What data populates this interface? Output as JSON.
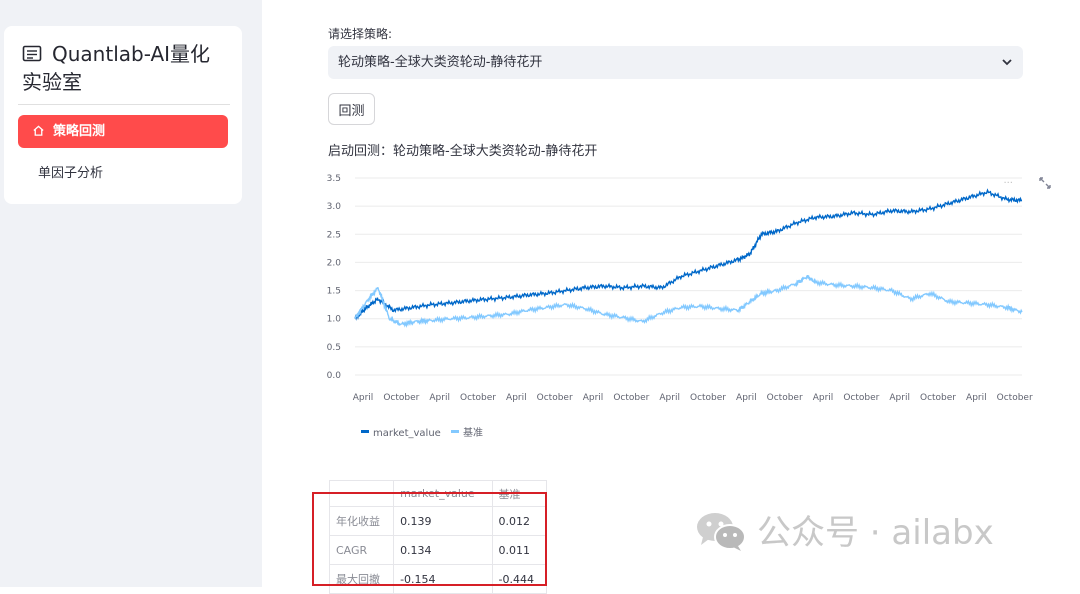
{
  "sidebar": {
    "title": "Quantlab-AI量化实验室",
    "items": [
      {
        "label": "策略回测",
        "active": true
      },
      {
        "label": "单因子分析",
        "active": false
      }
    ]
  },
  "main": {
    "select_label": "请选择策略:",
    "select_value": "轮动策略-全球大类资轮动-静待花开",
    "run_button": "回测",
    "status": "启动回测：轮动策略-全球大类资轮动-静待花开"
  },
  "chart_data": {
    "type": "line",
    "title": "",
    "xlabel": "",
    "ylabel": "",
    "ylim": [
      0,
      3.5
    ],
    "yticks": [
      "0.0",
      "0.5",
      "1.0",
      "1.5",
      "2.0",
      "2.5",
      "3.0",
      "3.5"
    ],
    "xticks": [
      "April",
      "October",
      "April",
      "October",
      "April",
      "October",
      "April",
      "October",
      "April",
      "October",
      "April",
      "October",
      "April",
      "October",
      "April",
      "October",
      "April",
      "October"
    ],
    "grid": true,
    "legend": "bottom-left",
    "series": [
      {
        "name": "market_value",
        "color": "#0068c9",
        "points": [
          [
            0,
            1.0
          ],
          [
            0.3,
            1.2
          ],
          [
            0.6,
            1.35
          ],
          [
            1.0,
            1.15
          ],
          [
            1.5,
            1.2
          ],
          [
            2.0,
            1.25
          ],
          [
            2.5,
            1.28
          ],
          [
            3.0,
            1.32
          ],
          [
            3.5,
            1.35
          ],
          [
            4.0,
            1.38
          ],
          [
            4.5,
            1.42
          ],
          [
            5.0,
            1.45
          ],
          [
            5.5,
            1.5
          ],
          [
            6.0,
            1.55
          ],
          [
            6.5,
            1.58
          ],
          [
            7.0,
            1.55
          ],
          [
            7.5,
            1.58
          ],
          [
            8.0,
            1.55
          ],
          [
            8.5,
            1.75
          ],
          [
            9.0,
            1.85
          ],
          [
            9.5,
            1.95
          ],
          [
            10.0,
            2.05
          ],
          [
            10.3,
            2.15
          ],
          [
            10.6,
            2.5
          ],
          [
            11.0,
            2.55
          ],
          [
            11.5,
            2.7
          ],
          [
            12.0,
            2.8
          ],
          [
            12.5,
            2.82
          ],
          [
            13.0,
            2.88
          ],
          [
            13.5,
            2.85
          ],
          [
            14.0,
            2.92
          ],
          [
            14.5,
            2.9
          ],
          [
            15.0,
            2.95
          ],
          [
            15.5,
            3.05
          ],
          [
            16.0,
            3.15
          ],
          [
            16.5,
            3.25
          ],
          [
            17.0,
            3.12
          ],
          [
            17.4,
            3.1
          ]
        ]
      },
      {
        "name": "基准",
        "color": "#83c9ff",
        "points": [
          [
            0,
            1.0
          ],
          [
            0.3,
            1.3
          ],
          [
            0.6,
            1.55
          ],
          [
            0.9,
            1.0
          ],
          [
            1.2,
            0.9
          ],
          [
            1.6,
            0.95
          ],
          [
            2.0,
            0.97
          ],
          [
            2.5,
            1.0
          ],
          [
            3.0,
            1.02
          ],
          [
            3.5,
            1.05
          ],
          [
            4.0,
            1.08
          ],
          [
            4.5,
            1.15
          ],
          [
            5.0,
            1.2
          ],
          [
            5.5,
            1.25
          ],
          [
            6.0,
            1.18
          ],
          [
            6.5,
            1.08
          ],
          [
            7.0,
            1.02
          ],
          [
            7.5,
            0.95
          ],
          [
            8.0,
            1.1
          ],
          [
            8.5,
            1.2
          ],
          [
            9.0,
            1.22
          ],
          [
            9.5,
            1.18
          ],
          [
            10.0,
            1.15
          ],
          [
            10.3,
            1.3
          ],
          [
            10.6,
            1.45
          ],
          [
            11.0,
            1.5
          ],
          [
            11.5,
            1.62
          ],
          [
            11.8,
            1.75
          ],
          [
            12.0,
            1.65
          ],
          [
            12.5,
            1.6
          ],
          [
            13.0,
            1.58
          ],
          [
            13.5,
            1.55
          ],
          [
            14.0,
            1.5
          ],
          [
            14.5,
            1.35
          ],
          [
            15.0,
            1.45
          ],
          [
            15.5,
            1.3
          ],
          [
            16.0,
            1.28
          ],
          [
            16.5,
            1.25
          ],
          [
            17.0,
            1.2
          ],
          [
            17.4,
            1.12
          ]
        ]
      }
    ]
  },
  "metrics_table": {
    "columns": [
      "",
      "market_value",
      "基准"
    ],
    "rows": [
      [
        "年化收益",
        "0.139",
        "0.012"
      ],
      [
        "CAGR",
        "0.134",
        "0.011"
      ],
      [
        "最大回撤",
        "-0.154",
        "-0.444"
      ]
    ]
  },
  "watermark": "公众号 · ailabx",
  "colors": {
    "accent": "#ff4b4b",
    "highlight_box": "#d61f26"
  }
}
